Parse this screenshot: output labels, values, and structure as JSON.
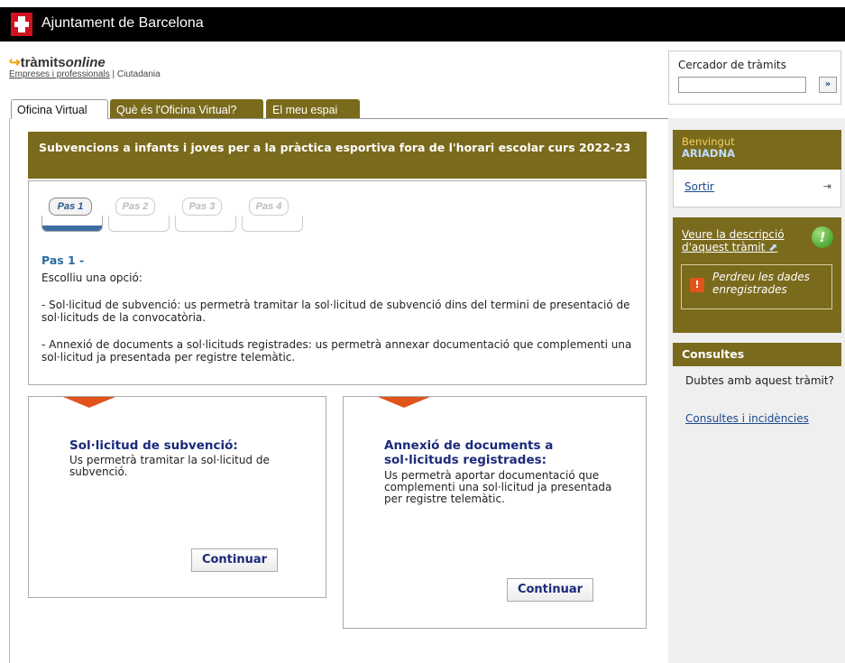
{
  "header": {
    "title": "Ajuntament de Barcelona"
  },
  "brand": {
    "name_prefix": "tràmits",
    "name_suffix": "online",
    "sub_link": "Empreses i professionals",
    "sub_sep": " | ",
    "sub_other": "Ciutadania"
  },
  "search": {
    "label": "Cercador de tràmits",
    "value": "",
    "button": "»"
  },
  "tabs": [
    {
      "label": "Oficina Virtual"
    },
    {
      "label": "Què és l'Oficina Virtual?"
    },
    {
      "label": "El meu espai"
    }
  ],
  "procedure": {
    "title": "Subvencions a infants i joves per a la pràctica esportiva fora de l'horari escolar curs 2022-23"
  },
  "steps": [
    {
      "label": "Pas 1",
      "active": true
    },
    {
      "label": "Pas 2",
      "active": false
    },
    {
      "label": "Pas 3",
      "active": false
    },
    {
      "label": "Pas 4",
      "active": false
    }
  ],
  "step_content": {
    "title": "Pas 1 -",
    "intro": "Escolliu una opció:",
    "option1": "- Sol·licitud de subvenció: us permetrà tramitar la sol·licitud de subvenció dins del termini de presentació de sol·licituds de la convocatòria.",
    "option2": "- Annexió de documents a sol·licituds registrades: us permetrà annexar documentació que complementi una sol·licitud ja presentada per registre telemàtic."
  },
  "cards": [
    {
      "title": "Sol·licitud de subvenció:",
      "desc": "Us permetrà tramitar la sol·licitud de subvenció.",
      "button": "Continuar"
    },
    {
      "title": "Annexió de documents a sol·licituds registrades:",
      "desc": "Us permetrà aportar documentació que complementi una sol·licitud ja presentada per registre telemàtic.",
      "button": "Continuar"
    }
  ],
  "sidebar": {
    "welcome": "Benvingut",
    "user": "ARIADNA",
    "logout": "Sortir",
    "description_link": "Veure la descripció d'aquest tràmit",
    "warning": "Perdreu les dades enregistrades",
    "consult_title": "Consultes",
    "consult_text": "Dubtes amb aquest tràmit?",
    "consult_link": "Consultes i incidències"
  }
}
